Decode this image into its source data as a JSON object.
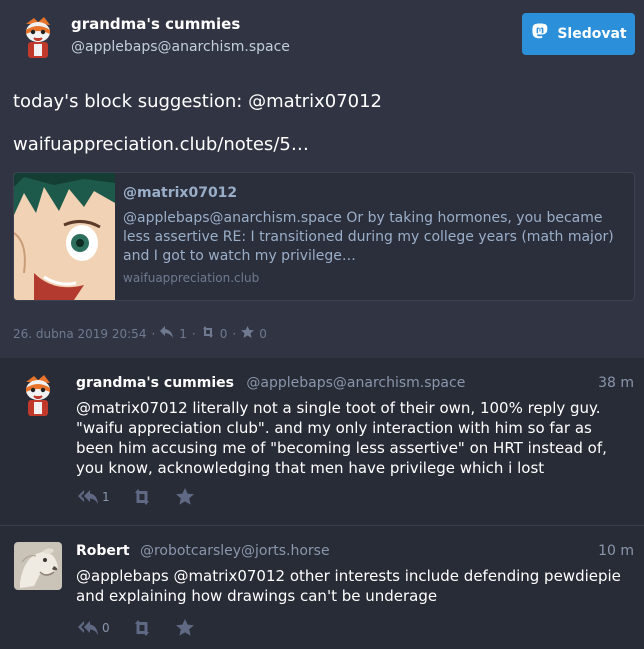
{
  "main_status": {
    "display_name": "grandma's cummies",
    "account": "@applebaps@anarchism.space",
    "follow_label": "Sledovat",
    "text_line1": "today's block suggestion: @matrix07012",
    "text_line2": "waifuappreciation.club/notes/5…",
    "card": {
      "title": "@matrix07012",
      "description": "@applebaps@anarchism.space Or by taking hormones, you became less assertive RE: I transitioned during my college years (math major) and I got to watch my privilege…",
      "host": "waifuappreciation.club"
    },
    "timestamp": "26. dubna 2019 20:54",
    "reply_count": "1",
    "boost_count": "0",
    "fav_count": "0"
  },
  "replies": [
    {
      "display_name": "grandma's cummies",
      "account": "@applebaps@anarchism.space",
      "time": "38 m",
      "text": "@matrix07012 literally not a single toot of their own, 100% reply guy.  \"waifu appreciation club\".  and my only interaction with him so far as been him accusing me of \"becoming less assertive\" on HRT instead of, you know, acknowledging that men have privilege which i lost",
      "reply_count": "1"
    },
    {
      "display_name": "Robert",
      "account": "@robotcarsley@jorts.horse",
      "time": "10 m",
      "text": "@applebaps @matrix07012 other interests include defending pewdiepie and explaining how drawings can't be underage",
      "reply_count": "0"
    }
  ],
  "colors": {
    "accent": "#2b90d9",
    "background": "#282c37",
    "main_background": "#313543"
  }
}
